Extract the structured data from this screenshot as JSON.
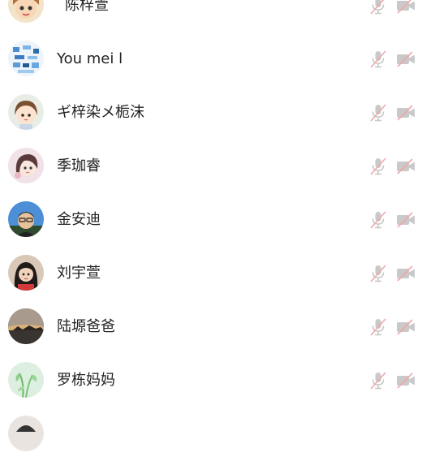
{
  "participants": [
    {
      "name": "陈梓萱",
      "avatar_icon": "cartoon-girl-avatar",
      "mic_icon": "mic-muted-icon",
      "camera_icon": "camera-off-icon"
    },
    {
      "name": "You mei l",
      "avatar_icon": "colorful-pattern-avatar",
      "mic_icon": "mic-muted-icon",
      "camera_icon": "camera-off-icon"
    },
    {
      "name": "ギ梓染メ栀沫",
      "avatar_icon": "anime-girl-avatar",
      "mic_icon": "mic-muted-icon",
      "camera_icon": "camera-off-icon"
    },
    {
      "name": "季珈睿",
      "avatar_icon": "anime-girl-pink-avatar",
      "mic_icon": "mic-muted-icon",
      "camera_icon": "camera-off-icon"
    },
    {
      "name": "金安迪",
      "avatar_icon": "boy-photo-avatar",
      "mic_icon": "mic-muted-icon",
      "camera_icon": "camera-off-icon"
    },
    {
      "name": "刘宇萱",
      "avatar_icon": "girl-photo-avatar",
      "mic_icon": "mic-muted-icon",
      "camera_icon": "camera-off-icon"
    },
    {
      "name": "陆塬爸爸",
      "avatar_icon": "sunset-landscape-avatar",
      "mic_icon": "mic-muted-icon",
      "camera_icon": "camera-off-icon"
    },
    {
      "name": "罗栋妈妈",
      "avatar_icon": "green-plant-avatar",
      "mic_icon": "mic-muted-icon",
      "camera_icon": "camera-off-icon"
    }
  ],
  "colors": {
    "icon_gray": "#c9c9c9",
    "mute_slash": "#f0a8a8",
    "name_text": "#222222"
  }
}
